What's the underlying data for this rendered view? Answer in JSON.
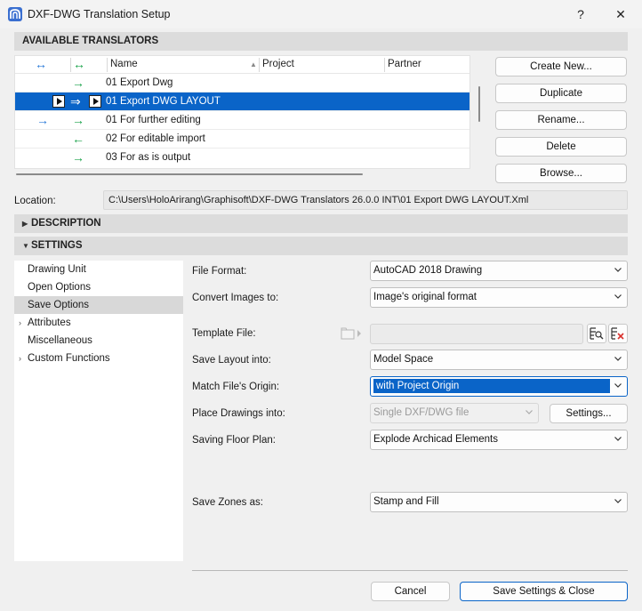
{
  "window": {
    "title": "DXF-DWG Translation Setup",
    "help_label": "?",
    "close_label": "✕"
  },
  "translators": {
    "header": "AVAILABLE TRANSLATORS",
    "columns": {
      "name": "Name",
      "project": "Project",
      "partner": "Partner"
    },
    "rows": [
      {
        "name": "01 Export Dwg",
        "selected": false
      },
      {
        "name": "01 Export DWG LAYOUT",
        "selected": true
      },
      {
        "name": "01 For further editing",
        "selected": false
      },
      {
        "name": "02 For editable import",
        "selected": false
      },
      {
        "name": "03 For as is output",
        "selected": false
      }
    ],
    "buttons": {
      "create_new": "Create New...",
      "duplicate": "Duplicate",
      "rename": "Rename...",
      "delete": "Delete",
      "browse": "Browse..."
    }
  },
  "location": {
    "label": "Location:",
    "value": "C:\\Users\\HoloArirang\\Graphisoft\\DXF-DWG Translators 26.0.0 INT\\01 Export DWG LAYOUT.Xml"
  },
  "description": {
    "header": "DESCRIPTION"
  },
  "settings": {
    "header": "SETTINGS",
    "categories": [
      {
        "label": "Drawing Unit",
        "expandable": false
      },
      {
        "label": "Open Options",
        "expandable": false
      },
      {
        "label": "Save Options",
        "expandable": false,
        "selected": true
      },
      {
        "label": "Attributes",
        "expandable": true
      },
      {
        "label": "Miscellaneous",
        "expandable": false
      },
      {
        "label": "Custom Functions",
        "expandable": true
      }
    ],
    "fields": {
      "file_format": {
        "label": "File Format:",
        "value": "AutoCAD 2018 Drawing"
      },
      "convert_images": {
        "label": "Convert Images to:",
        "value": "Image's original format"
      },
      "template_file": {
        "label": "Template File:",
        "value": ""
      },
      "save_layout": {
        "label": "Save Layout into:",
        "value": "Model Space"
      },
      "match_origin": {
        "label": "Match File's Origin:",
        "value": "with Project Origin"
      },
      "place_drawings": {
        "label": "Place Drawings into:",
        "value": "Single DXF/DWG file",
        "button": "Settings..."
      },
      "saving_floor_plan": {
        "label": "Saving Floor Plan:",
        "value": "Explode Archicad Elements"
      },
      "save_zones": {
        "label": "Save Zones as:",
        "value": "Stamp and Fill"
      }
    }
  },
  "footer": {
    "cancel": "Cancel",
    "save_close": "Save Settings & Close"
  },
  "colors": {
    "selection": "#0a64c8",
    "green_arrow": "#1aa34a",
    "blue_arrow": "#2a7ad8",
    "section_bar": "#dcdcdc"
  },
  "icons": [
    "app-icon",
    "help-icon",
    "close-icon",
    "bidirectional-arrow-icon",
    "right-arrow-icon",
    "left-arrow-icon",
    "play-icon",
    "folder-icon",
    "browse-file-icon",
    "clear-file-icon",
    "chevron-down-icon"
  ]
}
